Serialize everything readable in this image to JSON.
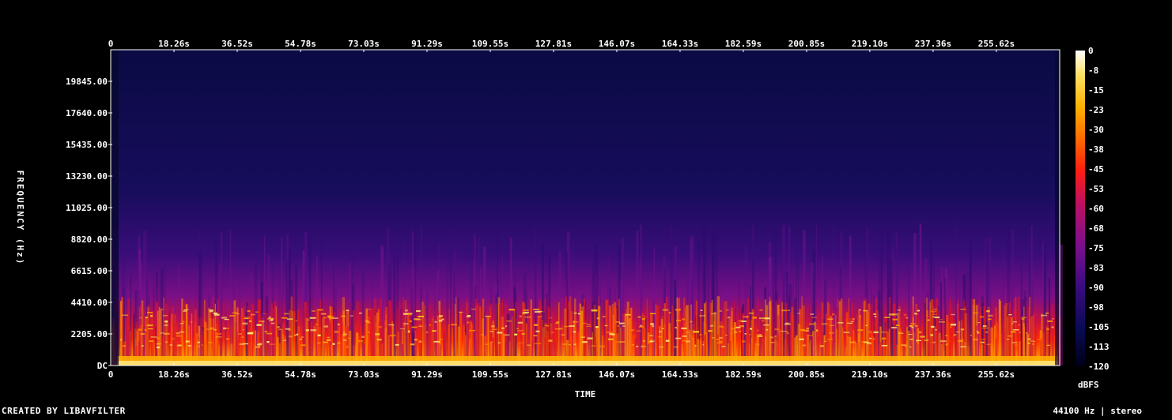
{
  "chart_data": {
    "type": "heatmap",
    "title": "",
    "xlabel": "TIME",
    "ylabel": "FREQUENCY (Hz)",
    "x_ticks": [
      "0",
      "18.26s",
      "36.52s",
      "54.78s",
      "73.03s",
      "91.29s",
      "109.55s",
      "127.81s",
      "146.07s",
      "164.33s",
      "182.59s",
      "200.85s",
      "219.10s",
      "237.36s",
      "255.62s"
    ],
    "x_tick_values": [
      0,
      18.26,
      36.52,
      54.78,
      73.03,
      91.29,
      109.55,
      127.81,
      146.07,
      164.33,
      182.59,
      200.85,
      219.1,
      237.36,
      255.62
    ],
    "xlim": [
      0,
      273.9
    ],
    "y_ticks": [
      "DC",
      "2205.00",
      "4410.00",
      "6615.00",
      "8820.00",
      "11025.00",
      "13230.00",
      "15435.00",
      "17640.00",
      "19845.00"
    ],
    "y_tick_values": [
      0,
      2205,
      4410,
      6615,
      8820,
      11025,
      13230,
      15435,
      17640,
      19845
    ],
    "ylim": [
      0,
      22050
    ],
    "colorbar": {
      "label": "dBFS",
      "ticks": [
        "0",
        "-8",
        "-15",
        "-23",
        "-30",
        "-38",
        "-45",
        "-53",
        "-60",
        "-68",
        "-75",
        "-83",
        "-90",
        "-98",
        "-105",
        "-113",
        "-120"
      ],
      "range": [
        -120,
        0
      ],
      "colors": [
        "#000018",
        "#0a0a55",
        "#3a0b80",
        "#7a0f8e",
        "#c01060",
        "#ff1e10",
        "#ff6a00",
        "#ffb000",
        "#ffe060",
        "#ffffff"
      ]
    },
    "energy_profile": {
      "description": "",
      "low_band_db": -30,
      "mid_band_db": -55,
      "high_band_db": -105
    }
  },
  "footer": {
    "left": "CREATED BY LIBAVFILTER",
    "right": "44100 Hz | stereo"
  }
}
